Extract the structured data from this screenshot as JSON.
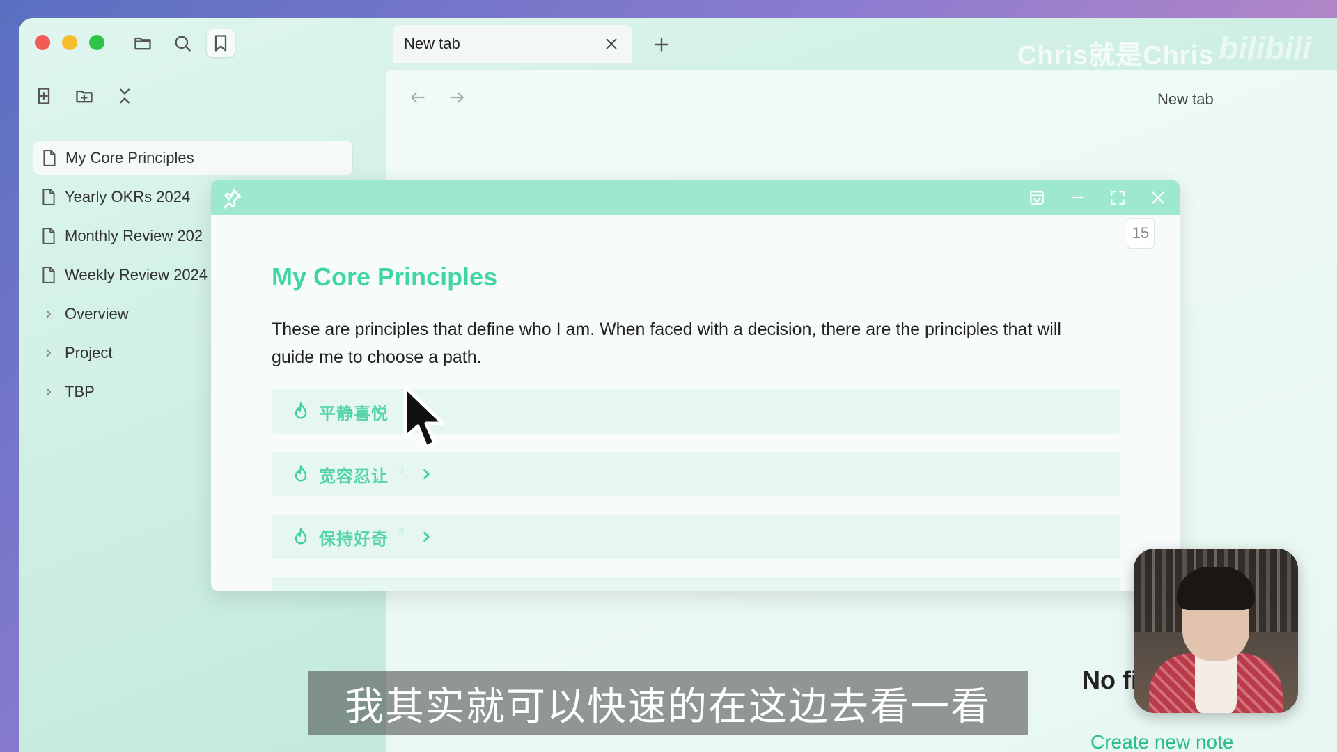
{
  "titlebar": {
    "tab_label": "New tab",
    "watermark": "Chris就是Chris",
    "watermark_logo": "bilibili"
  },
  "sidebar": {
    "items": [
      {
        "label": "My Core Principles",
        "type": "file",
        "selected": true
      },
      {
        "label": "Yearly OKRs 2024",
        "type": "file"
      },
      {
        "label": "Monthly Review 202",
        "type": "file"
      },
      {
        "label": "Weekly Review 2024",
        "type": "file"
      },
      {
        "label": "Overview",
        "type": "folder"
      },
      {
        "label": "Project",
        "type": "folder"
      },
      {
        "label": "TBP",
        "type": "folder"
      }
    ]
  },
  "main": {
    "pane_title": "New tab",
    "empty_title": "No file",
    "create_link": "Create new note"
  },
  "popover": {
    "badge": "15",
    "title": "My Core Principles",
    "description": "These are principles that define who I am. When faced with a decision, there are the principles that will guide me to choose a path.",
    "callouts": [
      {
        "title": "平静喜悦",
        "count": ""
      },
      {
        "title": "宽容忍让",
        "count": "3"
      },
      {
        "title": "保持好奇",
        "count": "3"
      }
    ]
  },
  "subtitle": "我其实就可以快速的在这边去看一看",
  "colors": {
    "accent": "#3fd6a4",
    "popover_header": "#9ee8cf",
    "link": "#2bbd8a"
  }
}
